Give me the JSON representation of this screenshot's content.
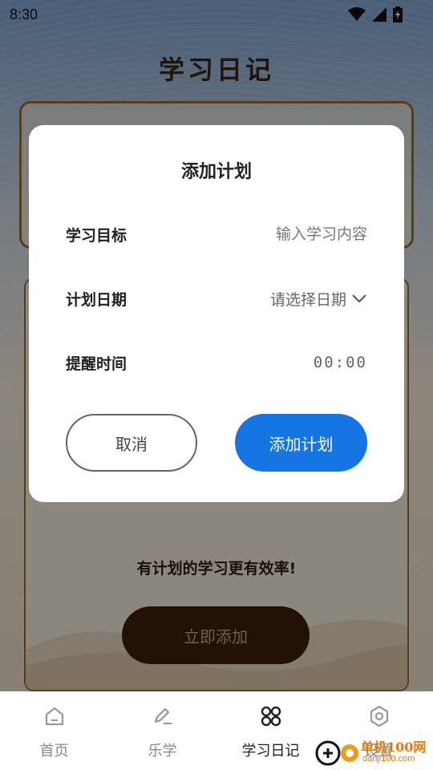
{
  "status_bar": {
    "time": "8:30"
  },
  "page": {
    "title": "学习日记",
    "motto": "有计划的学习更有效率!",
    "add_now_label": "立即添加"
  },
  "dialog": {
    "title": "添加计划",
    "goal": {
      "label": "学习目标",
      "placeholder": "输入学习内容",
      "value": ""
    },
    "date": {
      "label": "计划日期",
      "selected": "请选择日期"
    },
    "reminder": {
      "label": "提醒时间",
      "value": "00:00"
    },
    "cancel_label": "取消",
    "confirm_label": "添加计划"
  },
  "nav": {
    "items": [
      {
        "label": "首页",
        "icon": "home-icon",
        "active": false
      },
      {
        "label": "乐学",
        "icon": "edit-icon",
        "active": false
      },
      {
        "label": "学习日记",
        "icon": "grid-icon",
        "active": true
      },
      {
        "label": "设置",
        "icon": "settings-icon",
        "active": false
      }
    ]
  },
  "watermark": {
    "text": "单机100网",
    "url": "danji100.com"
  },
  "colors": {
    "accent": "#1475e3",
    "primary_dark": "#3b2009",
    "title_brown": "#3a2412"
  }
}
